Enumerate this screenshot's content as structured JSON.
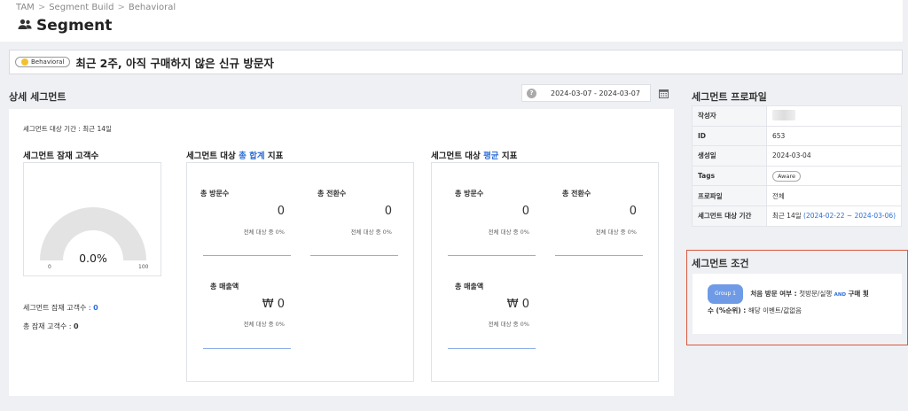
{
  "breadcrumb": [
    "TAM",
    "Segment Build",
    "Behavioral"
  ],
  "breadcrumb_sep": ">",
  "page": {
    "title": "Segment",
    "icon": "users-icon"
  },
  "segment": {
    "badge": "Behavioral",
    "badge_color": "#f2c12e",
    "name": "최근 2주, 아직 구매하지 않은 신규 방문자"
  },
  "detail": {
    "title": "상세 세그먼트",
    "date_range": "2024-03-07 - 2024-03-07",
    "period_label": "세그먼트 대상 기간 : 최근 14일",
    "potential": {
      "title": "세그먼트 잠재 고객수",
      "gauge_percent": "0.0%",
      "gauge_value": 0,
      "gauge_min": "0",
      "gauge_max": "100",
      "seg_count_label": "세그먼트 잠재 고객수 : ",
      "seg_count_value": "0",
      "total_count_label": "총 잠재 고객수 : ",
      "total_count_value": "0"
    },
    "total_metrics": {
      "title_pre": "세그먼트 대상 ",
      "title_hl": "총 합계",
      "title_post": " 지표",
      "visits_label": "총 방문수",
      "visits_value": "0",
      "visits_sub": "전체 대상 중 0%",
      "conversions_label": "총 전환수",
      "conversions_value": "0",
      "conversions_sub": "전체 대상 중 0%",
      "revenue_label": "총 매출액",
      "revenue_value": "₩ 0",
      "revenue_sub": "전체 대상 중 0%"
    },
    "avg_metrics": {
      "title_pre": "세그먼트 대상 ",
      "title_hl": "평균",
      "title_post": " 지표",
      "visits_label": "총 방문수",
      "visits_value": "0",
      "visits_sub": "전체 대상 중 0%",
      "conversions_label": "총 전환수",
      "conversions_value": "0",
      "conversions_sub": "전체 대상 중 0%",
      "revenue_label": "총 매출액",
      "revenue_value": "₩ 0",
      "revenue_sub": "전체 대상 중 0%"
    }
  },
  "profile": {
    "title": "세그먼트 프로파일",
    "rows": {
      "author_label": "작성자",
      "id_label": "ID",
      "id_value": "653",
      "created_label": "생성일",
      "created_value": "2024-03-04",
      "tags_label": "Tags",
      "tag_value": "Aware",
      "profile_label": "프로파일",
      "profile_value": "전체",
      "period_label": "세그먼트 대상 기간",
      "period_prefix": "최근 14일 ",
      "period_range": "(2024-02-22 ~ 2024-03-06)"
    }
  },
  "condition": {
    "title": "세그먼트 조건",
    "group": "Group 1",
    "line1_a": "처음 방문 여부 : ",
    "line1_b": "첫방문/실행",
    "and_label": "AND",
    "line1_c": "구매 횟",
    "line2_a": "수 (%순위) : ",
    "line2_b": "해당 이벤트/값없음"
  },
  "colors": {
    "accent": "#2f6fd6",
    "highlight_border": "#d9593b",
    "gauge": "#e3e3e3"
  }
}
